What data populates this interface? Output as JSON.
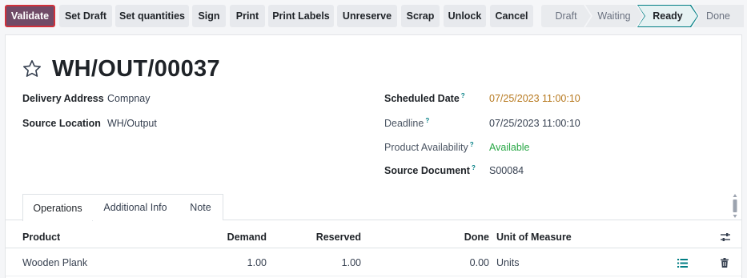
{
  "actions": {
    "validate": "Validate",
    "set_draft": "Set Draft",
    "set_quantities": "Set quantities",
    "sign": "Sign",
    "print": "Print",
    "print_labels": "Print Labels",
    "unreserve": "Unreserve",
    "scrap": "Scrap",
    "unlock": "Unlock",
    "cancel": "Cancel"
  },
  "statusbar": {
    "stages": [
      "Draft",
      "Waiting",
      "Ready",
      "Done"
    ],
    "active": "Ready"
  },
  "record": {
    "title": "WH/OUT/00037"
  },
  "fields": {
    "delivery_address": {
      "label": "Delivery Address",
      "value": "Compnay"
    },
    "source_location": {
      "label": "Source Location",
      "value": "WH/Output"
    },
    "scheduled_date": {
      "label": "Scheduled Date",
      "help": "?",
      "value": "07/25/2023 11:00:10"
    },
    "deadline": {
      "label": "Deadline",
      "help": "?",
      "value": "07/25/2023 11:00:10"
    },
    "product_availability": {
      "label": "Product Availability",
      "help": "?",
      "value": "Available"
    },
    "source_document": {
      "label": "Source Document",
      "help": "?",
      "value": "S00084"
    }
  },
  "tabs": [
    "Operations",
    "Additional Info",
    "Note"
  ],
  "table": {
    "columns": {
      "product": "Product",
      "demand": "Demand",
      "reserved": "Reserved",
      "done": "Done",
      "uom": "Unit of Measure"
    },
    "rows": [
      {
        "product": "Wooden Plank",
        "demand": "1.00",
        "reserved": "1.00",
        "done": "0.00",
        "uom": "Units"
      }
    ]
  },
  "colors": {
    "primary": "#714b67",
    "accent": "#017e84",
    "scheduled_date": "#b7791f",
    "available": "#28a745",
    "list_icon": "#017e84"
  },
  "icons": {
    "favorite": "star-outline-icon",
    "optional_columns": "sliders-icon",
    "details": "list-icon",
    "delete": "trash-icon"
  }
}
